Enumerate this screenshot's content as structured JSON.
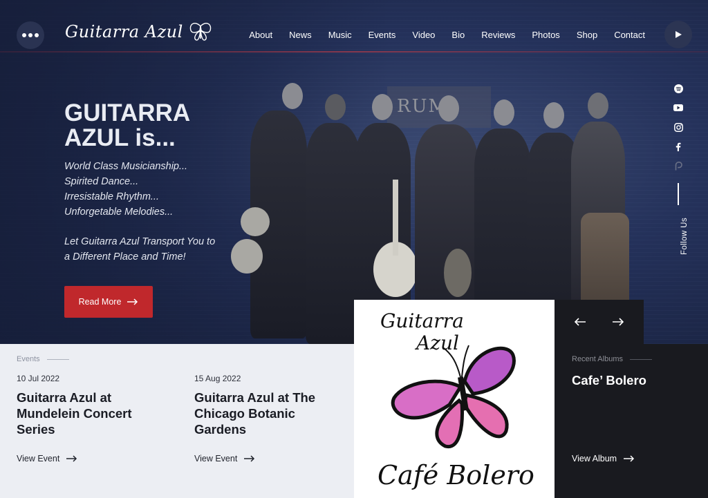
{
  "header": {
    "logo_text": "Guitarra Azul",
    "nav": [
      "About",
      "News",
      "Music",
      "Events",
      "Video",
      "Bio",
      "Reviews",
      "Photos",
      "Shop",
      "Contact"
    ]
  },
  "hero": {
    "title_line1": "GUITARRA",
    "title_line2": "AZUL is...",
    "lines": [
      "World Class Musicianship...",
      "Spirited Dance...",
      "Irresistable Rhythm...",
      "Unforgetable Melodies..."
    ],
    "tagline1": "Let Guitarra Azul Transport You to",
    "tagline2": "a Different Place and Time!",
    "button_label": "Read More",
    "sign_text": "RUM"
  },
  "social": {
    "icons": [
      "spotify-icon",
      "youtube-icon",
      "instagram-icon",
      "facebook-icon",
      "patreon-icon"
    ],
    "follow_label": "Follow Us"
  },
  "events": {
    "label": "Events",
    "items": [
      {
        "date": "10 Jul 2022",
        "title": "Guitarra Azul at Mundelein Concert Series",
        "link": "View Event"
      },
      {
        "date": "15 Aug 2022",
        "title": "Guitarra Azul at The Chicago Botanic Gardens",
        "link": "View Event"
      }
    ]
  },
  "album_art": {
    "line1": "Guitarra",
    "line2": "Azul",
    "line3": "Café Bolero"
  },
  "albums": {
    "label": "Recent Albums",
    "name": "Cafe’ Bolero",
    "link": "View Album"
  },
  "colors": {
    "accent_red": "#c0282c",
    "hero_bg": "#24315a",
    "dark_panel": "#191a1f",
    "events_bg": "#eceef3"
  }
}
